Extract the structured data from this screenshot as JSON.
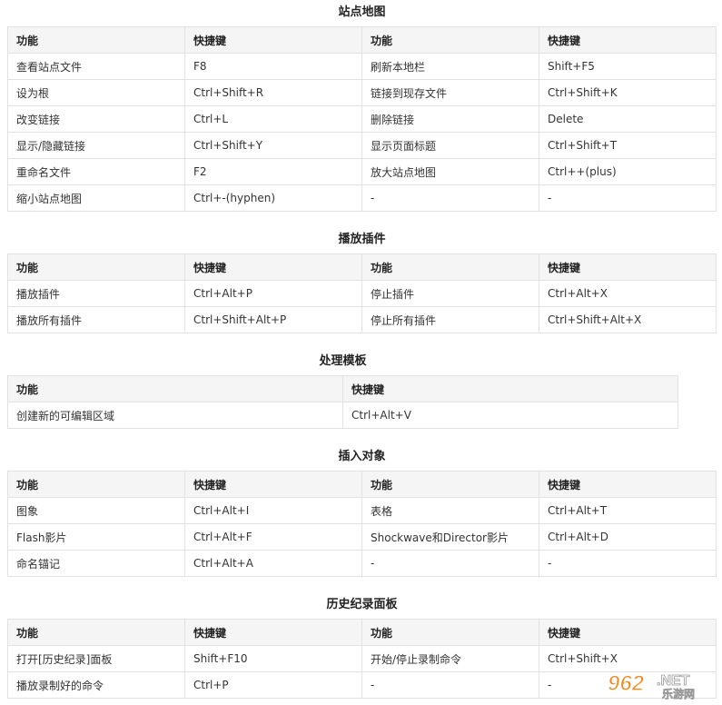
{
  "sections": [
    {
      "title": "站点地图",
      "headers": [
        "功能",
        "快捷键",
        "功能",
        "快捷键"
      ],
      "rows": [
        [
          "查看站点文件",
          "F8",
          "刷新本地栏",
          "Shift+F5"
        ],
        [
          "设为根",
          "Ctrl+Shift+R",
          "链接到现存文件",
          "Ctrl+Shift+K"
        ],
        [
          "改变链接",
          "Ctrl+L",
          "删除链接",
          "Delete"
        ],
        [
          "显示/隐藏链接",
          "Ctrl+Shift+Y",
          "显示页面标题",
          "Ctrl+Shift+T"
        ],
        [
          "重命名文件",
          "F2",
          "放大站点地图",
          "Ctrl++(plus)"
        ],
        [
          "缩小站点地图",
          "Ctrl+-(hyphen)",
          "-",
          "-"
        ]
      ]
    },
    {
      "title": "播放插件",
      "headers": [
        "功能",
        "快捷键",
        "功能",
        "快捷键"
      ],
      "rows": [
        [
          "播放插件",
          "Ctrl+Alt+P",
          "停止插件",
          "Ctrl+Alt+X"
        ],
        [
          "播放所有插件",
          "Ctrl+Shift+Alt+P",
          "停止所有插件",
          "Ctrl+Shift+Alt+X"
        ]
      ]
    },
    {
      "title": "处理模板",
      "headers": [
        "功能",
        "快捷键"
      ],
      "rows": [
        [
          "创建新的可编辑区域",
          "Ctrl+Alt+V"
        ]
      ]
    },
    {
      "title": "插入对象",
      "headers": [
        "功能",
        "快捷键",
        "功能",
        "快捷键"
      ],
      "rows": [
        [
          "图象",
          "Ctrl+Alt+I",
          "表格",
          "Ctrl+Alt+T"
        ],
        [
          "Flash影片",
          "Ctrl+Alt+F",
          "Shockwave和Director影片",
          "Ctrl+Alt+D"
        ],
        [
          "命名锚记",
          "Ctrl+Alt+A",
          "-",
          "-"
        ]
      ]
    },
    {
      "title": "历史纪录面板",
      "headers": [
        "功能",
        "快捷键",
        "功能",
        "快捷键"
      ],
      "rows": [
        [
          "打开[历史纪录]面板",
          "Shift+F10",
          "开始/停止录制命令",
          "Ctrl+Shift+X"
        ],
        [
          "播放录制好的命令",
          "Ctrl+P",
          "-",
          "-"
        ]
      ]
    }
  ],
  "watermark": {
    "brand": "962",
    "tld": ".NET",
    "sub": "乐游网",
    "color": "#f08a1e"
  }
}
